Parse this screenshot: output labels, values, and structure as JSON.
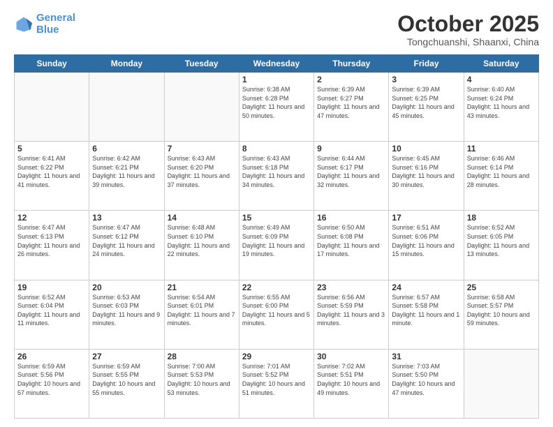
{
  "header": {
    "logo_line1": "General",
    "logo_line2": "Blue",
    "month": "October 2025",
    "location": "Tongchuanshi, Shaanxi, China"
  },
  "days_of_week": [
    "Sunday",
    "Monday",
    "Tuesday",
    "Wednesday",
    "Thursday",
    "Friday",
    "Saturday"
  ],
  "weeks": [
    [
      {
        "day": "",
        "sunrise": "",
        "sunset": "",
        "daylight": ""
      },
      {
        "day": "",
        "sunrise": "",
        "sunset": "",
        "daylight": ""
      },
      {
        "day": "",
        "sunrise": "",
        "sunset": "",
        "daylight": ""
      },
      {
        "day": "1",
        "sunrise": "Sunrise: 6:38 AM",
        "sunset": "Sunset: 6:28 PM",
        "daylight": "Daylight: 11 hours and 50 minutes."
      },
      {
        "day": "2",
        "sunrise": "Sunrise: 6:39 AM",
        "sunset": "Sunset: 6:27 PM",
        "daylight": "Daylight: 11 hours and 47 minutes."
      },
      {
        "day": "3",
        "sunrise": "Sunrise: 6:39 AM",
        "sunset": "Sunset: 6:25 PM",
        "daylight": "Daylight: 11 hours and 45 minutes."
      },
      {
        "day": "4",
        "sunrise": "Sunrise: 6:40 AM",
        "sunset": "Sunset: 6:24 PM",
        "daylight": "Daylight: 11 hours and 43 minutes."
      }
    ],
    [
      {
        "day": "5",
        "sunrise": "Sunrise: 6:41 AM",
        "sunset": "Sunset: 6:22 PM",
        "daylight": "Daylight: 11 hours and 41 minutes."
      },
      {
        "day": "6",
        "sunrise": "Sunrise: 6:42 AM",
        "sunset": "Sunset: 6:21 PM",
        "daylight": "Daylight: 11 hours and 39 minutes."
      },
      {
        "day": "7",
        "sunrise": "Sunrise: 6:43 AM",
        "sunset": "Sunset: 6:20 PM",
        "daylight": "Daylight: 11 hours and 37 minutes."
      },
      {
        "day": "8",
        "sunrise": "Sunrise: 6:43 AM",
        "sunset": "Sunset: 6:18 PM",
        "daylight": "Daylight: 11 hours and 34 minutes."
      },
      {
        "day": "9",
        "sunrise": "Sunrise: 6:44 AM",
        "sunset": "Sunset: 6:17 PM",
        "daylight": "Daylight: 11 hours and 32 minutes."
      },
      {
        "day": "10",
        "sunrise": "Sunrise: 6:45 AM",
        "sunset": "Sunset: 6:16 PM",
        "daylight": "Daylight: 11 hours and 30 minutes."
      },
      {
        "day": "11",
        "sunrise": "Sunrise: 6:46 AM",
        "sunset": "Sunset: 6:14 PM",
        "daylight": "Daylight: 11 hours and 28 minutes."
      }
    ],
    [
      {
        "day": "12",
        "sunrise": "Sunrise: 6:47 AM",
        "sunset": "Sunset: 6:13 PM",
        "daylight": "Daylight: 11 hours and 26 minutes."
      },
      {
        "day": "13",
        "sunrise": "Sunrise: 6:47 AM",
        "sunset": "Sunset: 6:12 PM",
        "daylight": "Daylight: 11 hours and 24 minutes."
      },
      {
        "day": "14",
        "sunrise": "Sunrise: 6:48 AM",
        "sunset": "Sunset: 6:10 PM",
        "daylight": "Daylight: 11 hours and 22 minutes."
      },
      {
        "day": "15",
        "sunrise": "Sunrise: 6:49 AM",
        "sunset": "Sunset: 6:09 PM",
        "daylight": "Daylight: 11 hours and 19 minutes."
      },
      {
        "day": "16",
        "sunrise": "Sunrise: 6:50 AM",
        "sunset": "Sunset: 6:08 PM",
        "daylight": "Daylight: 11 hours and 17 minutes."
      },
      {
        "day": "17",
        "sunrise": "Sunrise: 6:51 AM",
        "sunset": "Sunset: 6:06 PM",
        "daylight": "Daylight: 11 hours and 15 minutes."
      },
      {
        "day": "18",
        "sunrise": "Sunrise: 6:52 AM",
        "sunset": "Sunset: 6:05 PM",
        "daylight": "Daylight: 11 hours and 13 minutes."
      }
    ],
    [
      {
        "day": "19",
        "sunrise": "Sunrise: 6:52 AM",
        "sunset": "Sunset: 6:04 PM",
        "daylight": "Daylight: 11 hours and 11 minutes."
      },
      {
        "day": "20",
        "sunrise": "Sunrise: 6:53 AM",
        "sunset": "Sunset: 6:03 PM",
        "daylight": "Daylight: 11 hours and 9 minutes."
      },
      {
        "day": "21",
        "sunrise": "Sunrise: 6:54 AM",
        "sunset": "Sunset: 6:01 PM",
        "daylight": "Daylight: 11 hours and 7 minutes."
      },
      {
        "day": "22",
        "sunrise": "Sunrise: 6:55 AM",
        "sunset": "Sunset: 6:00 PM",
        "daylight": "Daylight: 11 hours and 5 minutes."
      },
      {
        "day": "23",
        "sunrise": "Sunrise: 6:56 AM",
        "sunset": "Sunset: 5:59 PM",
        "daylight": "Daylight: 11 hours and 3 minutes."
      },
      {
        "day": "24",
        "sunrise": "Sunrise: 6:57 AM",
        "sunset": "Sunset: 5:58 PM",
        "daylight": "Daylight: 11 hours and 1 minute."
      },
      {
        "day": "25",
        "sunrise": "Sunrise: 6:58 AM",
        "sunset": "Sunset: 5:57 PM",
        "daylight": "Daylight: 10 hours and 59 minutes."
      }
    ],
    [
      {
        "day": "26",
        "sunrise": "Sunrise: 6:59 AM",
        "sunset": "Sunset: 5:56 PM",
        "daylight": "Daylight: 10 hours and 57 minutes."
      },
      {
        "day": "27",
        "sunrise": "Sunrise: 6:59 AM",
        "sunset": "Sunset: 5:55 PM",
        "daylight": "Daylight: 10 hours and 55 minutes."
      },
      {
        "day": "28",
        "sunrise": "Sunrise: 7:00 AM",
        "sunset": "Sunset: 5:53 PM",
        "daylight": "Daylight: 10 hours and 53 minutes."
      },
      {
        "day": "29",
        "sunrise": "Sunrise: 7:01 AM",
        "sunset": "Sunset: 5:52 PM",
        "daylight": "Daylight: 10 hours and 51 minutes."
      },
      {
        "day": "30",
        "sunrise": "Sunrise: 7:02 AM",
        "sunset": "Sunset: 5:51 PM",
        "daylight": "Daylight: 10 hours and 49 minutes."
      },
      {
        "day": "31",
        "sunrise": "Sunrise: 7:03 AM",
        "sunset": "Sunset: 5:50 PM",
        "daylight": "Daylight: 10 hours and 47 minutes."
      },
      {
        "day": "",
        "sunrise": "",
        "sunset": "",
        "daylight": ""
      }
    ]
  ]
}
